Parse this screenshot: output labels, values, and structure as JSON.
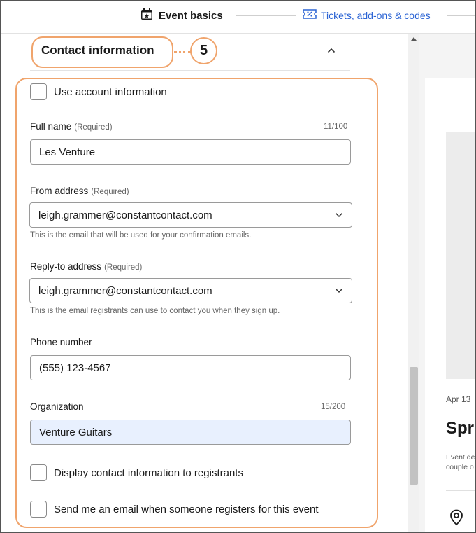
{
  "header": {
    "tab_event_basics": "Event basics",
    "tab_tickets": "Tickets, add-ons & codes"
  },
  "section": {
    "title": "Contact information",
    "callout_number": "5"
  },
  "form": {
    "use_account": {
      "label": "Use account information",
      "checked": false
    },
    "full_name": {
      "label": "Full name",
      "required": "(Required)",
      "counter": "11/100",
      "value": "Les Venture"
    },
    "from_address": {
      "label": "From address",
      "required": "(Required)",
      "value": "leigh.grammer@constantcontact.com",
      "help": "This is the email that will be used for your confirmation emails."
    },
    "reply_to": {
      "label": "Reply-to address",
      "required": "(Required)",
      "value": "leigh.grammer@constantcontact.com",
      "help": "This is the email registrants can use to contact you when they sign up."
    },
    "phone": {
      "label": "Phone number",
      "value": "(555) 123-4567"
    },
    "organization": {
      "label": "Organization",
      "counter": "15/200",
      "value": "Venture Guitars"
    },
    "display_contact": {
      "label": "Display contact information to registrants",
      "checked": false
    },
    "send_email": {
      "label": "Send me an email when someone registers for this event",
      "checked": false
    }
  },
  "preview": {
    "date": "Apr 13",
    "title": "Spri",
    "desc_line1": "Event de",
    "desc_line2": "couple o"
  },
  "colors": {
    "accent_link": "#2a63d4",
    "callout": "#f0a46c",
    "autofill": "#e8f0fe"
  }
}
